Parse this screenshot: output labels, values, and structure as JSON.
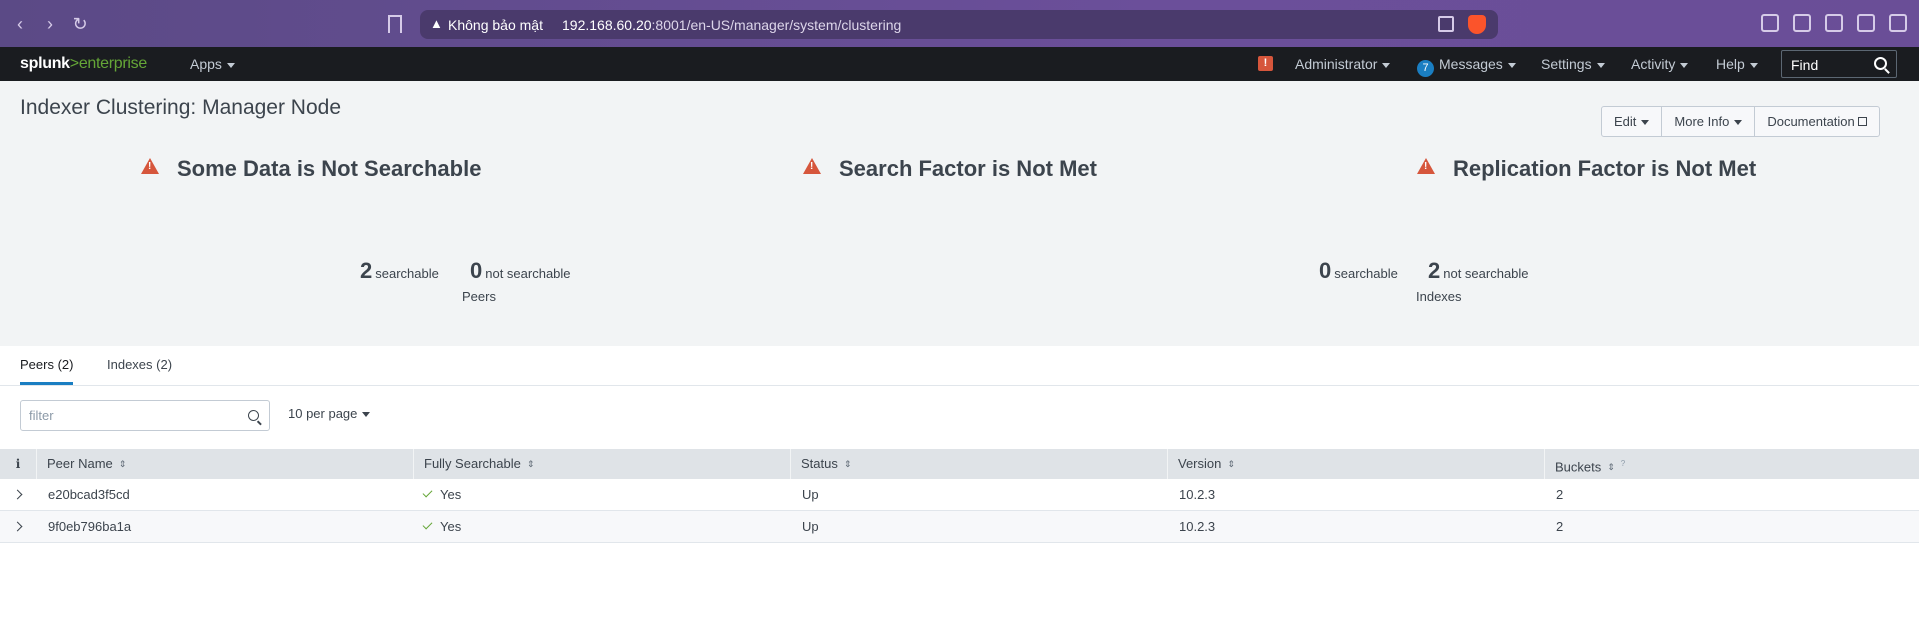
{
  "browser": {
    "insecure_label": "Không bảo mật",
    "url_host": "192.168.60.20",
    "url_rest": ":8001/en-US/manager/system/clustering"
  },
  "topbar": {
    "logo_splunk": "splunk",
    "logo_gt": ">",
    "logo_enterprise": "enterprise",
    "apps": "Apps",
    "alert_glyph": "!",
    "user": "Administrator",
    "messages_count": "7",
    "messages": "Messages",
    "settings": "Settings",
    "activity": "Activity",
    "help": "Help",
    "find_placeholder": "Find"
  },
  "header": {
    "title": "Indexer Clustering: Manager Node",
    "buttons": {
      "edit": "Edit",
      "more_info": "More Info",
      "documentation": "Documentation"
    }
  },
  "status": {
    "searchable_title": "Some Data is Not Searchable",
    "search_factor_title": "Search Factor is Not Met",
    "replication_factor_title": "Replication Factor is Not Met",
    "peers": {
      "searchable": "2",
      "searchable_label": "searchable",
      "not_searchable": "0",
      "not_searchable_label": "not searchable",
      "caption": "Peers"
    },
    "indexes": {
      "searchable": "0",
      "searchable_label": "searchable",
      "not_searchable": "2",
      "not_searchable_label": "not searchable",
      "caption": "Indexes"
    }
  },
  "tabs": {
    "peers": "Peers (2)",
    "indexes": "Indexes (2)"
  },
  "toolbar": {
    "filter_placeholder": "filter",
    "per_page": "10 per page"
  },
  "table": {
    "info_glyph": "i",
    "columns": {
      "peer_name": "Peer Name",
      "fully_searchable": "Fully Searchable",
      "status": "Status",
      "version": "Version",
      "buckets": "Buckets",
      "buckets_hint": "?"
    },
    "rows": [
      {
        "peer_name": "e20bcad3f5cd",
        "fully_searchable": "Yes",
        "status": "Up",
        "version": "10.2.3",
        "buckets": "2"
      },
      {
        "peer_name": "9f0eb796ba1a",
        "fully_searchable": "Yes",
        "status": "Up",
        "version": "10.2.3",
        "buckets": "2"
      }
    ]
  },
  "colors": {
    "accent": "#1a7ec2",
    "warning": "#d6563c",
    "success": "#65a637",
    "topbar_bg": "#1a1c20"
  }
}
